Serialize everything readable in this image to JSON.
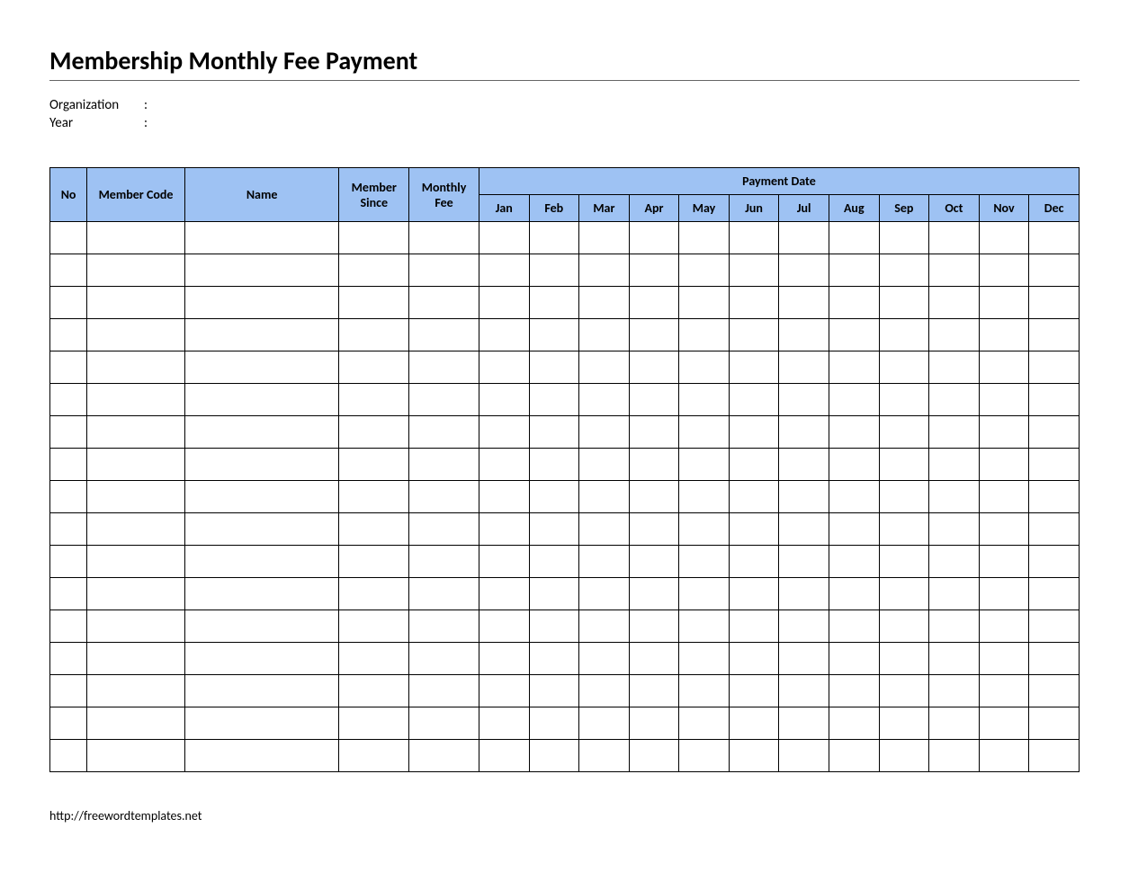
{
  "title": "Membership Monthly Fee Payment",
  "meta": {
    "organization_label": "Organization",
    "organization_value": "",
    "year_label": "Year",
    "year_value": "",
    "colon": ":"
  },
  "headers": {
    "no": "No",
    "member_code": "Member Code",
    "name": "Name",
    "member_since": "Member Since",
    "monthly_fee": "Monthly Fee",
    "payment_date": "Payment Date",
    "months": [
      "Jan",
      "Feb",
      "Mar",
      "Apr",
      "May",
      "Jun",
      "Jul",
      "Aug",
      "Sep",
      "Oct",
      "Nov",
      "Dec"
    ]
  },
  "rows": [
    {
      "no": "",
      "code": "",
      "name": "",
      "since": "",
      "fee": "",
      "months": [
        "",
        "",
        "",
        "",
        "",
        "",
        "",
        "",
        "",
        "",
        "",
        ""
      ]
    },
    {
      "no": "",
      "code": "",
      "name": "",
      "since": "",
      "fee": "",
      "months": [
        "",
        "",
        "",
        "",
        "",
        "",
        "",
        "",
        "",
        "",
        "",
        ""
      ]
    },
    {
      "no": "",
      "code": "",
      "name": "",
      "since": "",
      "fee": "",
      "months": [
        "",
        "",
        "",
        "",
        "",
        "",
        "",
        "",
        "",
        "",
        "",
        ""
      ]
    },
    {
      "no": "",
      "code": "",
      "name": "",
      "since": "",
      "fee": "",
      "months": [
        "",
        "",
        "",
        "",
        "",
        "",
        "",
        "",
        "",
        "",
        "",
        ""
      ]
    },
    {
      "no": "",
      "code": "",
      "name": "",
      "since": "",
      "fee": "",
      "months": [
        "",
        "",
        "",
        "",
        "",
        "",
        "",
        "",
        "",
        "",
        "",
        ""
      ]
    },
    {
      "no": "",
      "code": "",
      "name": "",
      "since": "",
      "fee": "",
      "months": [
        "",
        "",
        "",
        "",
        "",
        "",
        "",
        "",
        "",
        "",
        "",
        ""
      ]
    },
    {
      "no": "",
      "code": "",
      "name": "",
      "since": "",
      "fee": "",
      "months": [
        "",
        "",
        "",
        "",
        "",
        "",
        "",
        "",
        "",
        "",
        "",
        ""
      ]
    },
    {
      "no": "",
      "code": "",
      "name": "",
      "since": "",
      "fee": "",
      "months": [
        "",
        "",
        "",
        "",
        "",
        "",
        "",
        "",
        "",
        "",
        "",
        ""
      ]
    },
    {
      "no": "",
      "code": "",
      "name": "",
      "since": "",
      "fee": "",
      "months": [
        "",
        "",
        "",
        "",
        "",
        "",
        "",
        "",
        "",
        "",
        "",
        ""
      ]
    },
    {
      "no": "",
      "code": "",
      "name": "",
      "since": "",
      "fee": "",
      "months": [
        "",
        "",
        "",
        "",
        "",
        "",
        "",
        "",
        "",
        "",
        "",
        ""
      ]
    },
    {
      "no": "",
      "code": "",
      "name": "",
      "since": "",
      "fee": "",
      "months": [
        "",
        "",
        "",
        "",
        "",
        "",
        "",
        "",
        "",
        "",
        "",
        ""
      ]
    },
    {
      "no": "",
      "code": "",
      "name": "",
      "since": "",
      "fee": "",
      "months": [
        "",
        "",
        "",
        "",
        "",
        "",
        "",
        "",
        "",
        "",
        "",
        ""
      ]
    },
    {
      "no": "",
      "code": "",
      "name": "",
      "since": "",
      "fee": "",
      "months": [
        "",
        "",
        "",
        "",
        "",
        "",
        "",
        "",
        "",
        "",
        "",
        ""
      ]
    },
    {
      "no": "",
      "code": "",
      "name": "",
      "since": "",
      "fee": "",
      "months": [
        "",
        "",
        "",
        "",
        "",
        "",
        "",
        "",
        "",
        "",
        "",
        ""
      ]
    },
    {
      "no": "",
      "code": "",
      "name": "",
      "since": "",
      "fee": "",
      "months": [
        "",
        "",
        "",
        "",
        "",
        "",
        "",
        "",
        "",
        "",
        "",
        ""
      ]
    },
    {
      "no": "",
      "code": "",
      "name": "",
      "since": "",
      "fee": "",
      "months": [
        "",
        "",
        "",
        "",
        "",
        "",
        "",
        "",
        "",
        "",
        "",
        ""
      ]
    },
    {
      "no": "",
      "code": "",
      "name": "",
      "since": "",
      "fee": "",
      "months": [
        "",
        "",
        "",
        "",
        "",
        "",
        "",
        "",
        "",
        "",
        "",
        ""
      ]
    }
  ],
  "footer": "http://freewordtemplates.net"
}
